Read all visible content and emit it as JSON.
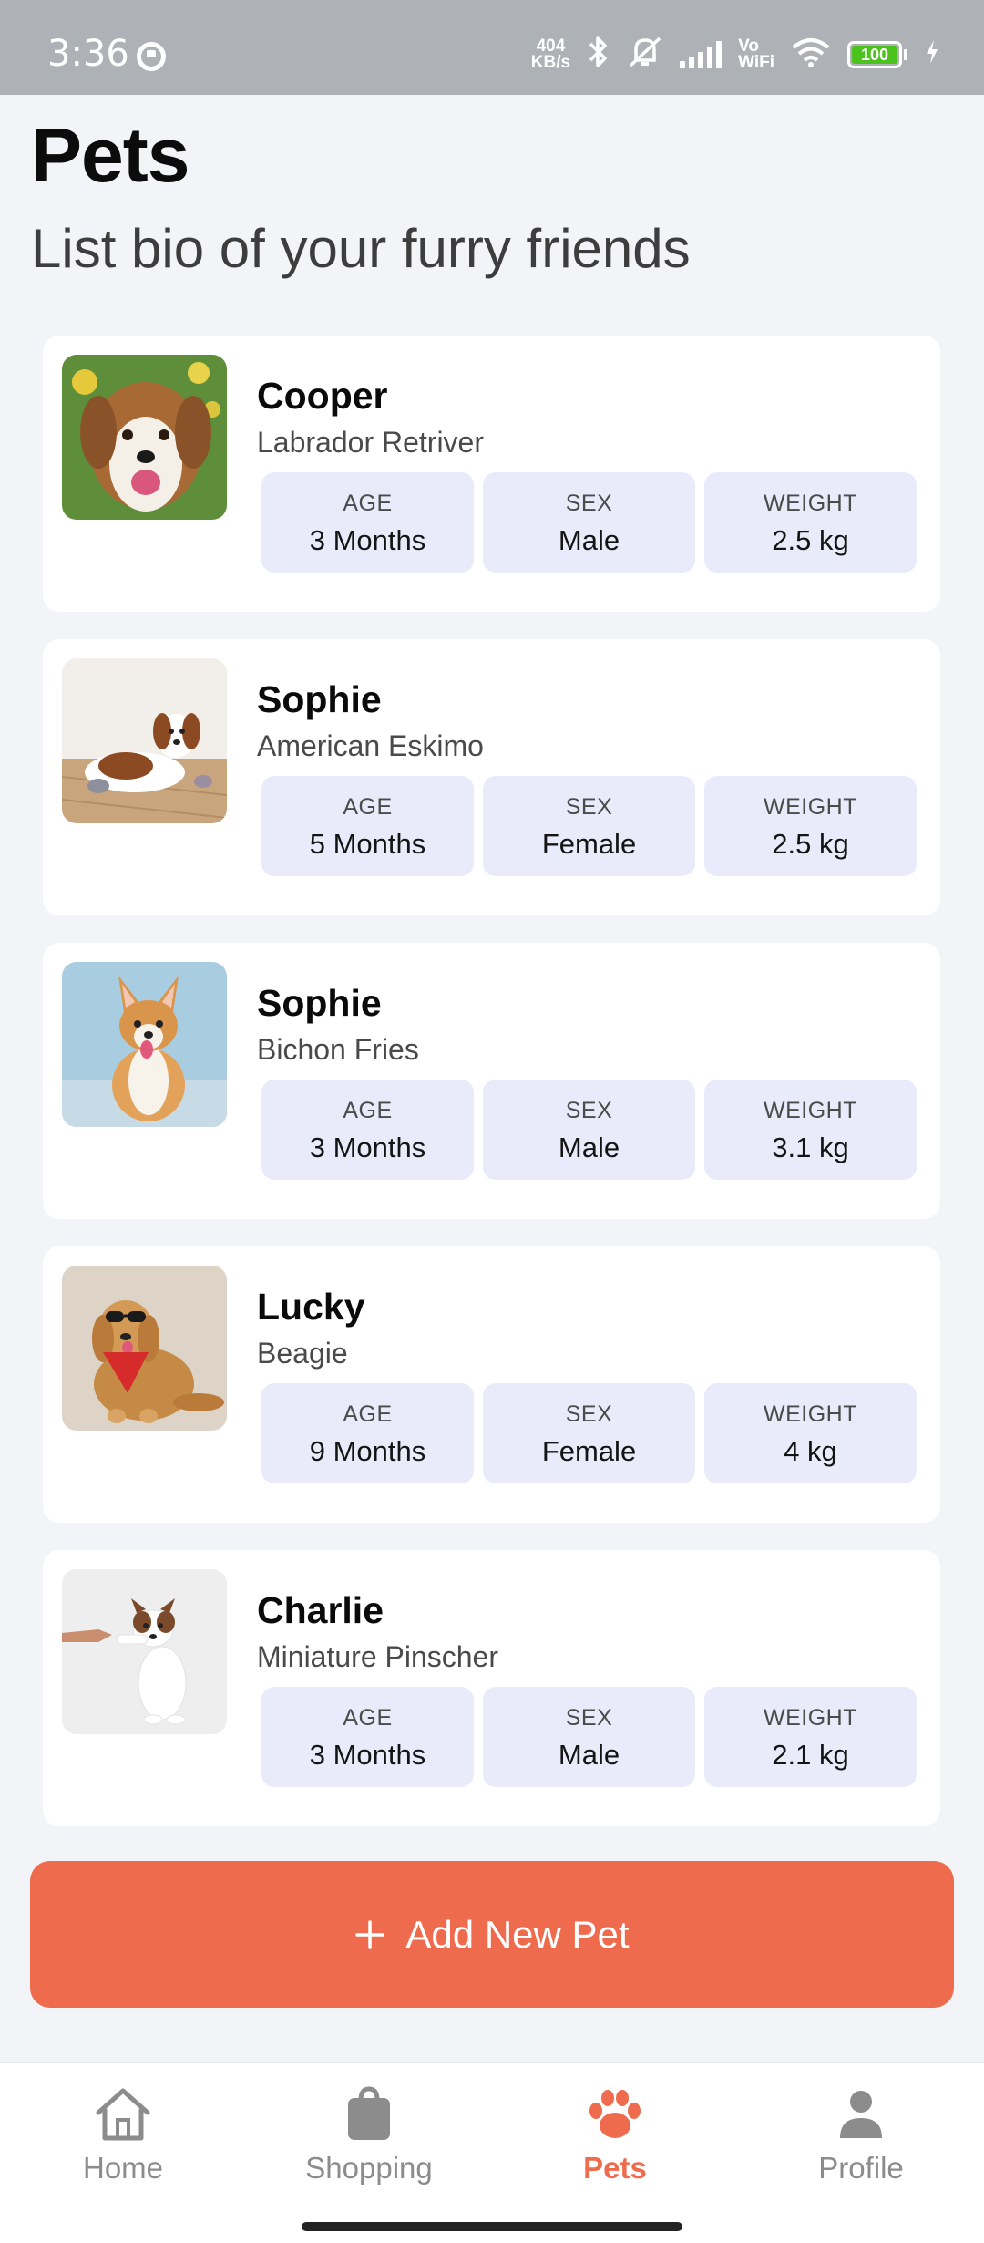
{
  "status_bar": {
    "time": "3:36",
    "net_speed_value": "404",
    "net_speed_unit": "KB/s",
    "vowifi_top": "Vo",
    "vowifi_bottom": "WiFi",
    "battery": "100"
  },
  "header": {
    "title": "Pets",
    "subtitle": "List bio of your furry friends"
  },
  "stat_labels": {
    "age": "AGE",
    "sex": "SEX",
    "weight": "WEIGHT"
  },
  "pets": [
    {
      "name": "Cooper",
      "breed": "Labrador Retriver",
      "age": "3 Months",
      "sex": "Male",
      "weight": "2.5 kg"
    },
    {
      "name": "Sophie",
      "breed": "American Eskimo",
      "age": "5 Months",
      "sex": "Female",
      "weight": "2.5 kg"
    },
    {
      "name": "Sophie",
      "breed": "Bichon Fries",
      "age": "3 Months",
      "sex": "Male",
      "weight": "3.1 kg"
    },
    {
      "name": "Lucky",
      "breed": "Beagie",
      "age": "9 Months",
      "sex": "Female",
      "weight": "4 kg"
    },
    {
      "name": "Charlie",
      "breed": "Miniature Pinscher",
      "age": "3 Months",
      "sex": "Male",
      "weight": "2.1 kg"
    }
  ],
  "add_button": {
    "icon": "plus-icon",
    "label": "Add New Pet"
  },
  "bottom_nav": {
    "items": [
      {
        "label": "Home",
        "icon": "home-icon"
      },
      {
        "label": "Shopping",
        "icon": "shopping-bag-icon"
      },
      {
        "label": "Pets",
        "icon": "paw-icon",
        "active": true
      },
      {
        "label": "Profile",
        "icon": "person-icon"
      }
    ]
  },
  "colors": {
    "accent": "#ef6b4d",
    "stat_chip": "#e9ebfa",
    "background": "#f3f4f8",
    "inactive_nav": "#8c8c8c"
  }
}
